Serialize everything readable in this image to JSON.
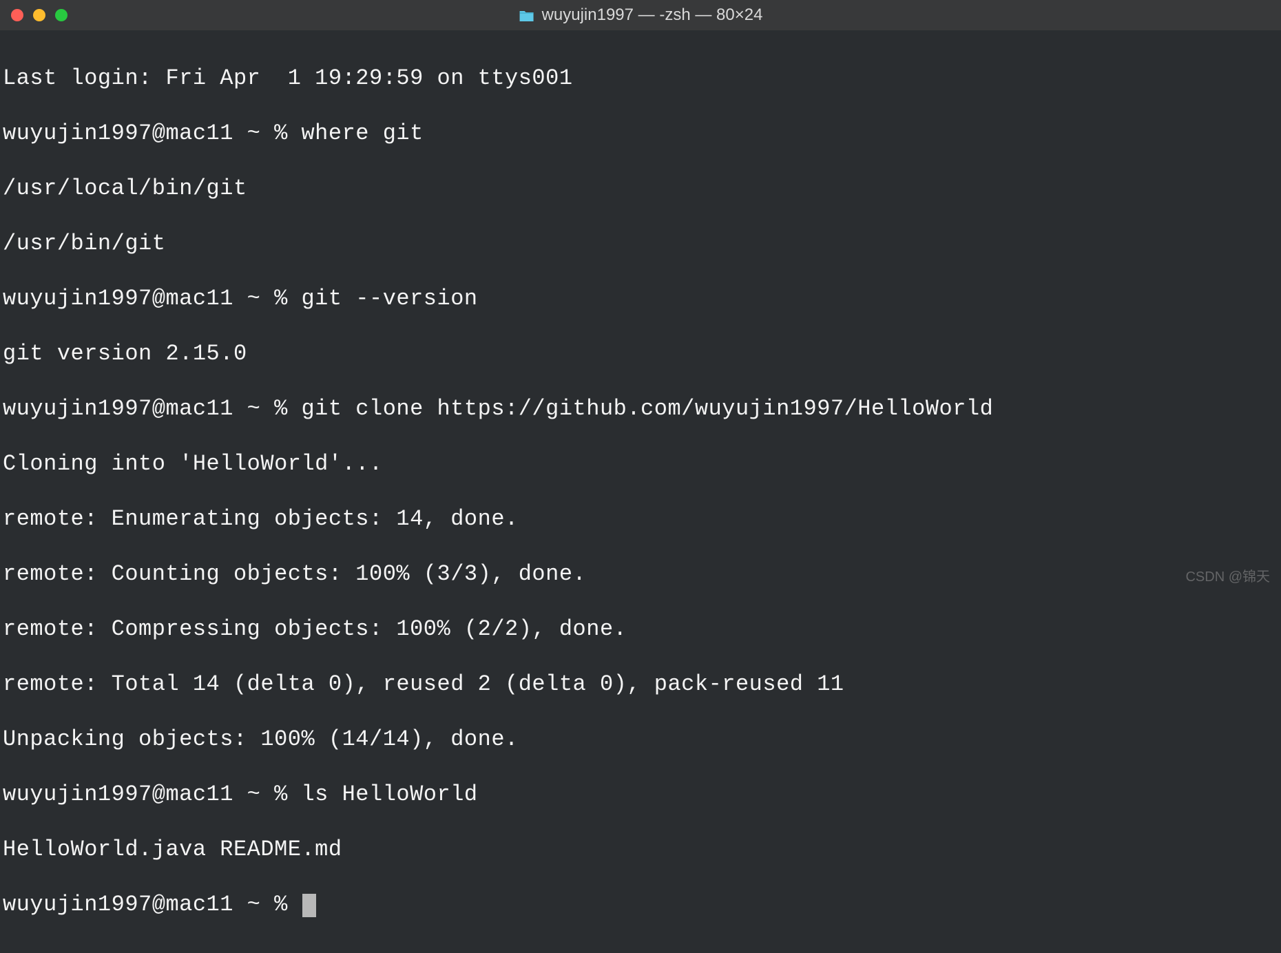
{
  "window": {
    "title": "wuyujin1997 — -zsh — 80×24"
  },
  "terminal": {
    "lines": [
      "Last login: Fri Apr  1 19:29:59 on ttys001",
      "wuyujin1997@mac11 ~ % where git",
      "/usr/local/bin/git",
      "/usr/bin/git",
      "wuyujin1997@mac11 ~ % git --version",
      "git version 2.15.0",
      "wuyujin1997@mac11 ~ % git clone https://github.com/wuyujin1997/HelloWorld",
      "Cloning into 'HelloWorld'...",
      "remote: Enumerating objects: 14, done.",
      "remote: Counting objects: 100% (3/3), done.",
      "remote: Compressing objects: 100% (2/2), done.",
      "remote: Total 14 (delta 0), reused 2 (delta 0), pack-reused 11",
      "Unpacking objects: 100% (14/14), done.",
      "wuyujin1997@mac11 ~ % ls HelloWorld",
      "HelloWorld.java README.md",
      "wuyujin1997@mac11 ~ % "
    ]
  },
  "watermark": "CSDN @锦天"
}
